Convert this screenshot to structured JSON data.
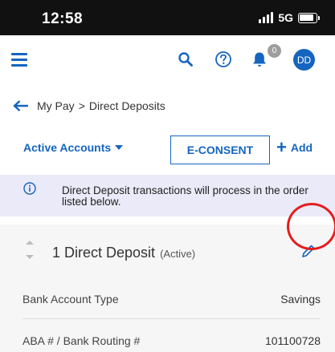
{
  "status_bar": {
    "time": "12:58",
    "network": "5G"
  },
  "header": {
    "notifications_count": "0",
    "avatar_initials": "DD"
  },
  "breadcrumb": {
    "parent": "My Pay",
    "separator": ">",
    "current": "Direct Deposits"
  },
  "toolbar": {
    "accounts_label": "Active Accounts",
    "econsent_label": "E-CONSENT",
    "add_label": "Add"
  },
  "info": {
    "text": "Direct Deposit transactions will process in the order listed below."
  },
  "deposit": {
    "title": "1 Direct Deposit",
    "status": "(Active)",
    "fields": [
      {
        "label": "Bank Account Type",
        "value": "Savings"
      },
      {
        "label": "ABA # / Bank Routing #",
        "value": "101100728"
      }
    ]
  },
  "colors": {
    "accent": "#1565c0",
    "status_bar": "#111111",
    "banner": "#eaeaf8",
    "highlight": "#e41d1d"
  },
  "icons": [
    "hamburger-icon",
    "search-icon",
    "help-icon",
    "bell-icon",
    "back-arrow-icon",
    "info-icon",
    "pencil-icon"
  ]
}
